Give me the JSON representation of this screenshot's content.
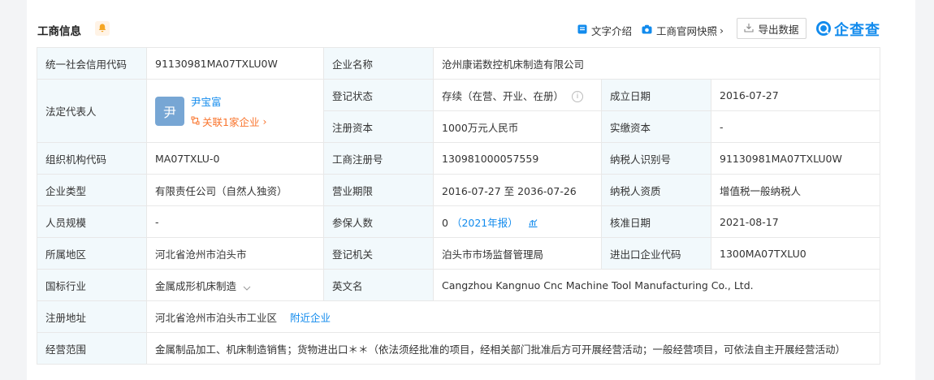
{
  "header": {
    "title": "工商信息",
    "intro_label": "文字介绍",
    "snapshot_label": "工商官网快照",
    "snapshot_arrow": "›",
    "export_label": "导出数据",
    "logo_text": "企查查"
  },
  "rows": {
    "credit_code": {
      "label": "统一社会信用代码",
      "value": "91130981MA07TXLU0W"
    },
    "company_name": {
      "label": "企业名称",
      "value": "沧州康诺数控机床制造有限公司"
    },
    "legal_rep": {
      "label": "法定代表人",
      "avatar_char": "尹",
      "name": "尹宝富",
      "related": "关联1家企业",
      "related_arrow": "›"
    },
    "reg_status": {
      "label": "登记状态",
      "value": "存续（在营、开业、在册）",
      "info_icon": "i"
    },
    "established": {
      "label": "成立日期",
      "value": "2016-07-27"
    },
    "reg_capital": {
      "label": "注册资本",
      "value": "1000万元人民币"
    },
    "paid_capital": {
      "label": "实缴资本",
      "value": "-"
    },
    "org_code": {
      "label": "组织机构代码",
      "value": "MA07TXLU-0"
    },
    "reg_no": {
      "label": "工商注册号",
      "value": "130981000057559"
    },
    "taxpayer_id": {
      "label": "纳税人识别号",
      "value": "91130981MA07TXLU0W"
    },
    "company_type": {
      "label": "企业类型",
      "value": "有限责任公司（自然人独资）"
    },
    "term": {
      "label": "营业期限",
      "value": "2016-07-27 至 2036-07-26"
    },
    "taxpayer_qual": {
      "label": "纳税人资质",
      "value": "增值税一般纳税人"
    },
    "staff": {
      "label": "人员规模",
      "value": "-"
    },
    "insured": {
      "label": "参保人数",
      "value": "0",
      "report": "（2021年报）"
    },
    "approve_date": {
      "label": "核准日期",
      "value": "2021-08-17"
    },
    "region": {
      "label": "所属地区",
      "value": "河北省沧州市泊头市"
    },
    "authority": {
      "label": "登记机关",
      "value": "泊头市市场监督管理局"
    },
    "ie_code": {
      "label": "进出口企业代码",
      "value": "1300MA07TXLU0"
    },
    "industry": {
      "label": "国标行业",
      "value": "金属成形机床制造"
    },
    "english_name": {
      "label": "英文名",
      "value": "Cangzhou Kangnuo Cnc Machine Tool Manufacturing Co., Ltd."
    },
    "address": {
      "label": "注册地址",
      "value": "河北省沧州市泊头市工业区",
      "nearby": "附近企业"
    },
    "scope": {
      "label": "经营范围",
      "value": "金属制品加工、机床制造销售；货物进出口＊＊（依法须经批准的项目，经相关部门批准后方可开展经营活动；一般经营项目，可依法自主开展经营活动）"
    }
  },
  "colors": {
    "accent": "#128bed",
    "orange": "#f9752e",
    "label_bg": "#f2f9fc"
  },
  "icons": [
    "bell-icon",
    "doc-icon",
    "camera-icon",
    "download-icon",
    "logo-icon",
    "link-icon",
    "info-icon",
    "chevron-down-icon",
    "chart-icon"
  ]
}
